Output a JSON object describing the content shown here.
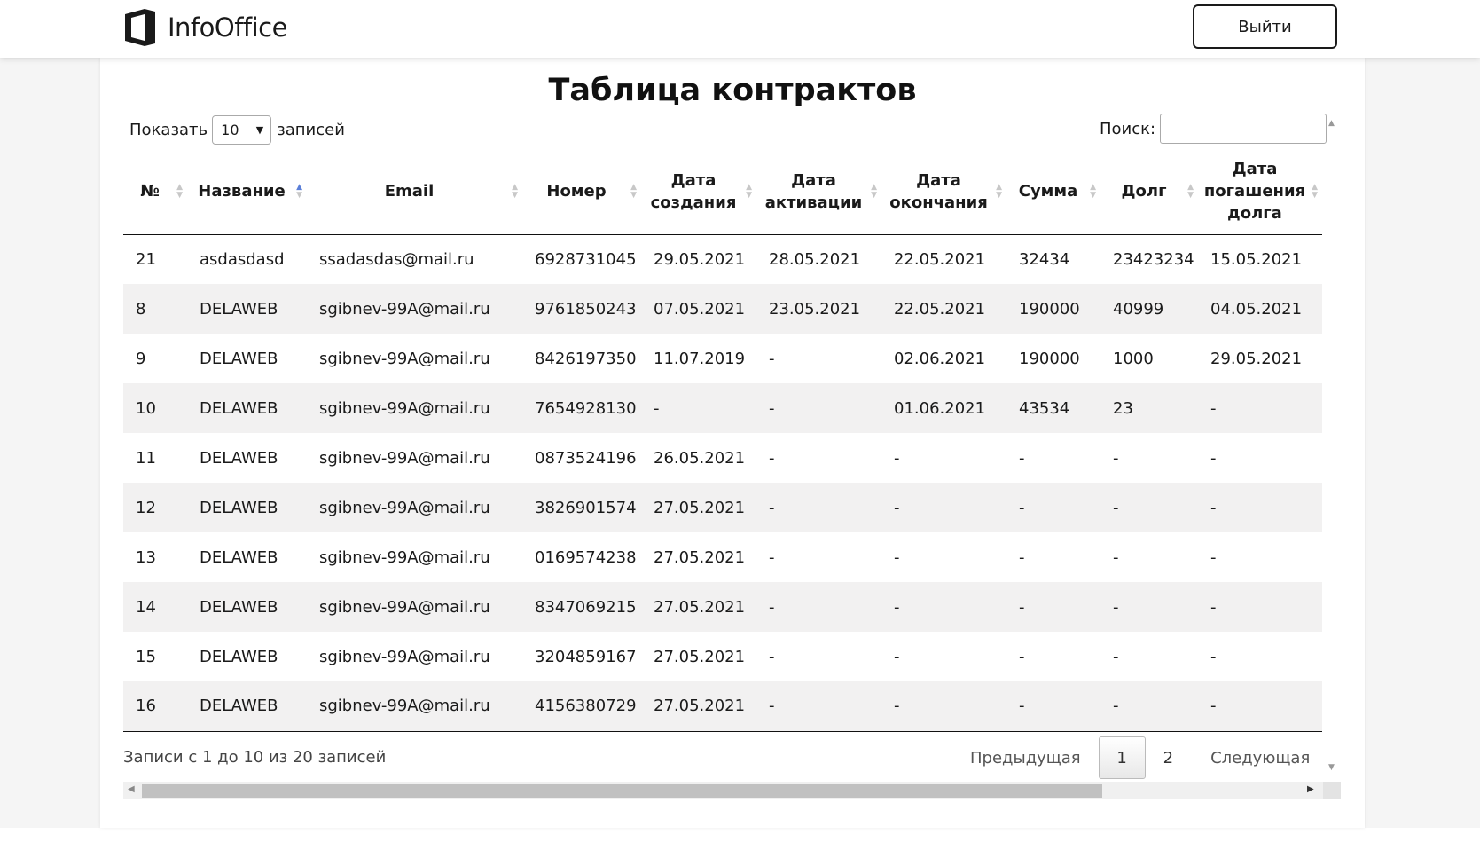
{
  "app": {
    "brand": "InfoOffice",
    "logout_label": "Выйти"
  },
  "page": {
    "title": "Таблица контрактов"
  },
  "controls": {
    "show_label": "Показать",
    "page_length": "10",
    "entries_label": "записей",
    "search_label": "Поиск:",
    "search_value": ""
  },
  "table": {
    "columns": [
      "№",
      "Название",
      "Email",
      "Номер",
      "Дата создания",
      "Дата активации",
      "Дата окончания",
      "Сумма",
      "Долг",
      "Дата погашения долга"
    ],
    "rows": [
      [
        "21",
        "asdasdasd",
        "ssadasdas@mail.ru",
        "6928731045",
        "29.05.2021",
        "28.05.2021",
        "22.05.2021",
        "32434",
        "23423234",
        "15.05.2021"
      ],
      [
        "8",
        "DELAWEB",
        "sgibnev-99A@mail.ru",
        "9761850243",
        "07.05.2021",
        "23.05.2021",
        "22.05.2021",
        "190000",
        "40999",
        "04.05.2021"
      ],
      [
        "9",
        "DELAWEB",
        "sgibnev-99A@mail.ru",
        "8426197350",
        "11.07.2019",
        "-",
        "02.06.2021",
        "190000",
        "1000",
        "29.05.2021"
      ],
      [
        "10",
        "DELAWEB",
        "sgibnev-99A@mail.ru",
        "7654928130",
        "-",
        "-",
        "01.06.2021",
        "43534",
        "23",
        "-"
      ],
      [
        "11",
        "DELAWEB",
        "sgibnev-99A@mail.ru",
        "0873524196",
        "26.05.2021",
        "-",
        "-",
        "-",
        "-",
        "-"
      ],
      [
        "12",
        "DELAWEB",
        "sgibnev-99A@mail.ru",
        "3826901574",
        "27.05.2021",
        "-",
        "-",
        "-",
        "-",
        "-"
      ],
      [
        "13",
        "DELAWEB",
        "sgibnev-99A@mail.ru",
        "0169574238",
        "27.05.2021",
        "-",
        "-",
        "-",
        "-",
        "-"
      ],
      [
        "14",
        "DELAWEB",
        "sgibnev-99A@mail.ru",
        "8347069215",
        "27.05.2021",
        "-",
        "-",
        "-",
        "-",
        "-"
      ],
      [
        "15",
        "DELAWEB",
        "sgibnev-99A@mail.ru",
        "3204859167",
        "27.05.2021",
        "-",
        "-",
        "-",
        "-",
        "-"
      ],
      [
        "16",
        "DELAWEB",
        "sgibnev-99A@mail.ru",
        "4156380729",
        "27.05.2021",
        "-",
        "-",
        "-",
        "-",
        "-"
      ]
    ]
  },
  "footer": {
    "info": "Записи с 1 до 10 из 20 записей",
    "prev_label": "Предыдущая",
    "current_page": "1",
    "page2_label": "2",
    "next_label": "Следующая"
  },
  "icons": {
    "logo": "infooffice-logo-icon",
    "sort": "sort-icon",
    "sort_asc": "sort-asc-icon"
  }
}
